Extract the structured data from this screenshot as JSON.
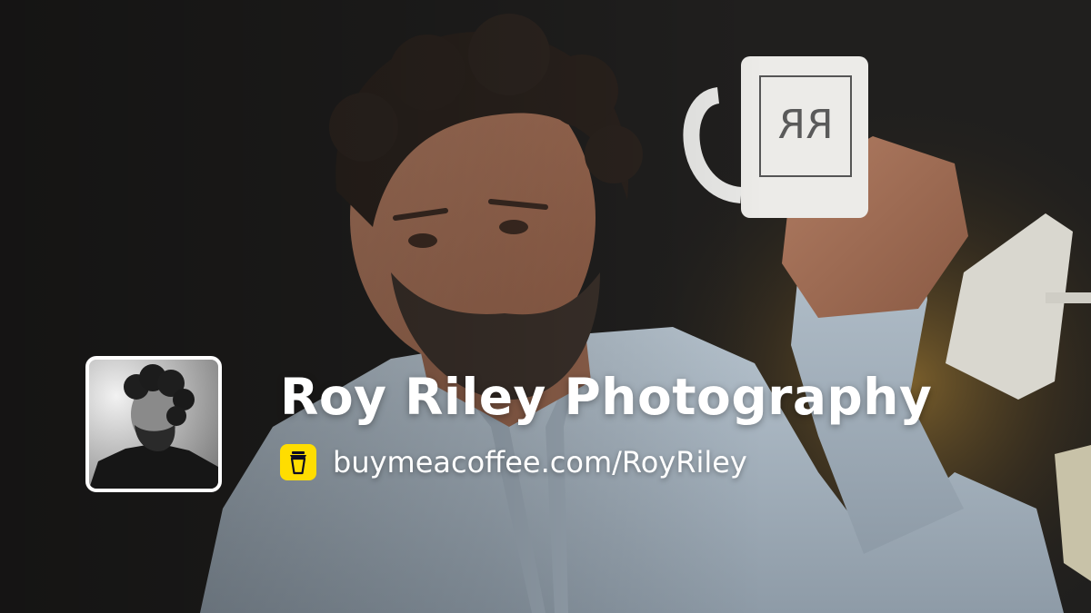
{
  "profile": {
    "name": "Roy Riley Photography",
    "avatar_icon": "profile-photo",
    "mug_logo_text": "RR"
  },
  "link": {
    "icon": "buymeacoffee-cup-icon",
    "url_text": "buymeacoffee.com/RoyRiley",
    "icon_color": "#FFDD00"
  },
  "colors": {
    "text": "#FFFFFF",
    "background": "#1F1E1D",
    "shirt": "#A9B6C2"
  }
}
